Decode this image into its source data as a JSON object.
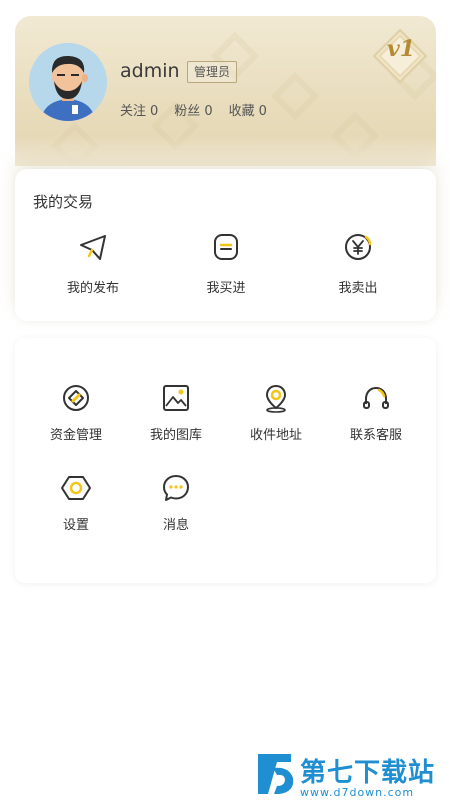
{
  "profile": {
    "username": "admin",
    "role": "管理员",
    "level": "v1",
    "stats": [
      {
        "label": "关注",
        "value": "0"
      },
      {
        "label": "粉丝",
        "value": "0"
      },
      {
        "label": "收藏",
        "value": "0"
      }
    ]
  },
  "trade": {
    "title": "我的交易",
    "items": [
      {
        "label": "我的发布",
        "icon": "send-icon"
      },
      {
        "label": "我买进",
        "icon": "wallet-icon"
      },
      {
        "label": "我卖出",
        "icon": "yen-coin-icon"
      }
    ]
  },
  "menu": {
    "items": [
      {
        "label": "资金管理",
        "icon": "funds-icon"
      },
      {
        "label": "我的图库",
        "icon": "gallery-icon"
      },
      {
        "label": "收件地址",
        "icon": "location-icon"
      },
      {
        "label": "联系客服",
        "icon": "headset-icon"
      },
      {
        "label": "设置",
        "icon": "settings-icon"
      },
      {
        "label": "消息",
        "icon": "message-icon"
      }
    ]
  },
  "watermark": {
    "title": "第七下载站",
    "url": "www.d7down.com"
  },
  "colors": {
    "accent": "#f5c518",
    "icon_stroke": "#333333",
    "card_gold": "#e8dcbc",
    "watermark_blue": "#1f8fd1"
  }
}
